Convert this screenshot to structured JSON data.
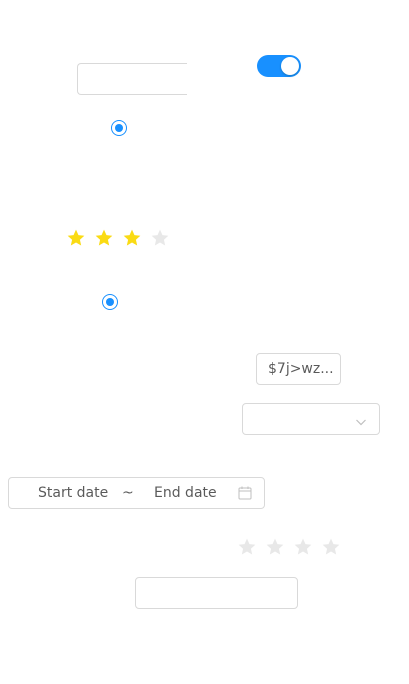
{
  "colors": {
    "primary": "#1890ff",
    "star_active": "#fadb14",
    "star_inactive": "#e8e8e8",
    "border": "#d9d9d9"
  },
  "switch": {
    "checked": true
  },
  "radio_top": {
    "checked": true
  },
  "rating_top": {
    "value": 3,
    "count": 4
  },
  "radio_middle": {
    "checked": true
  },
  "tag_input": {
    "value": "$7j>wz..."
  },
  "select": {
    "value": "",
    "icon": "chevron-down-icon"
  },
  "date_range": {
    "start_placeholder": "Start date",
    "separator": "~",
    "end_placeholder": "End date",
    "icon": "calendar-icon"
  },
  "rating_bottom": {
    "value": 0,
    "count": 4
  },
  "text_input_top": {
    "value": ""
  },
  "text_input_bottom": {
    "value": ""
  }
}
